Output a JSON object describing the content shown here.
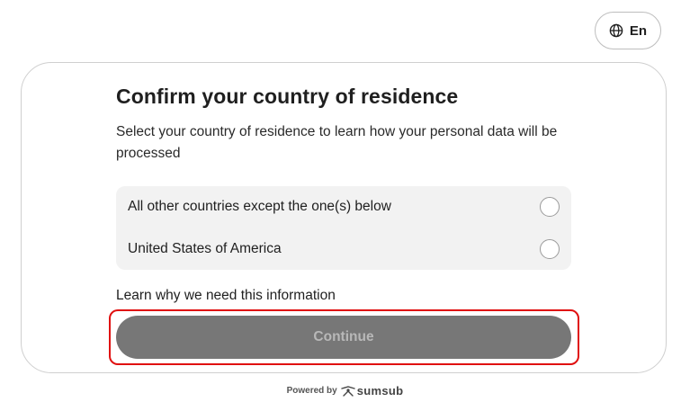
{
  "header": {
    "language_label": "En",
    "language_icon": "globe-icon"
  },
  "card": {
    "title": "Confirm your country of residence",
    "subtitle": "Select your country of residence to learn how your personal data will be processed",
    "options": [
      {
        "label": "All other countries except the one(s) below",
        "selected": false
      },
      {
        "label": "United States of America",
        "selected": false
      }
    ],
    "learn_link": "Learn why we need this information",
    "continue_label": "Continue"
  },
  "footer": {
    "powered_by": "Powered by",
    "brand": "sumsub",
    "brand_icon": "sumsub-logo-icon"
  },
  "colors": {
    "continue_bg": "#777777",
    "continue_text": "#b8b8b8",
    "highlight": "#e01010",
    "options_bg": "#f2f2f2"
  }
}
